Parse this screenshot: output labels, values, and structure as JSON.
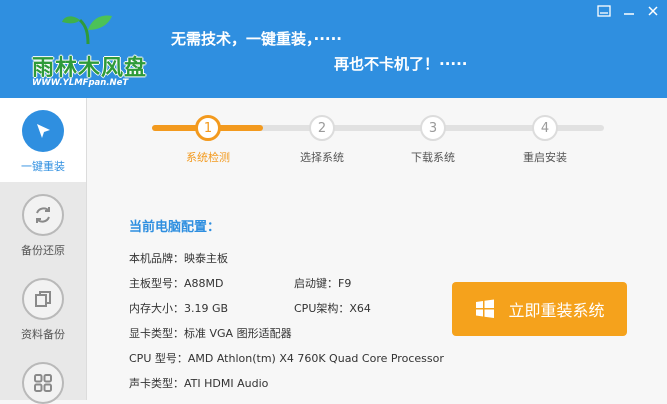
{
  "header": {
    "logo_text": "雨林木风盘",
    "logo_url": "WWW.YLMFpan.NeT",
    "slogan_line1": "无需技术，一键重装，·····",
    "slogan_line2": "再也不卡机了！·····"
  },
  "window": {
    "minimize_label": "",
    "close_label": ""
  },
  "sidebar": {
    "items": [
      {
        "label": "一键重装",
        "icon": "cursor-arrow-icon",
        "active": true
      },
      {
        "label": "备份还原",
        "icon": "refresh-icon",
        "active": false
      },
      {
        "label": "资料备份",
        "icon": "copy-icon",
        "active": false
      },
      {
        "label": "",
        "icon": "grid-icon",
        "active": false
      }
    ]
  },
  "steps": [
    {
      "number": "1",
      "label": "系统检测",
      "active": true
    },
    {
      "number": "2",
      "label": "选择系统",
      "active": false
    },
    {
      "number": "3",
      "label": "下载系统",
      "active": false
    },
    {
      "number": "4",
      "label": "重启安装",
      "active": false
    }
  ],
  "config": {
    "title": "当前电脑配置：",
    "brand": "本机品牌：映泰主板",
    "motherboard": "主板型号：A88MD",
    "boot_key": "启动键：F9",
    "memory": "内存大小：3.19 GB",
    "cpu_arch": "CPU架构：X64",
    "gpu": "显卡类型：标准 VGA 图形适配器",
    "cpu_model": "CPU 型号：AMD Athlon(tm) X4 760K Quad Core Processor",
    "sound": "声卡类型：ATI HDMI Audio"
  },
  "action": {
    "reinstall_label": "立即重装系统"
  },
  "colors": {
    "primary": "#2f8fe0",
    "accent": "#f39a1e",
    "button": "#f5a21c"
  }
}
